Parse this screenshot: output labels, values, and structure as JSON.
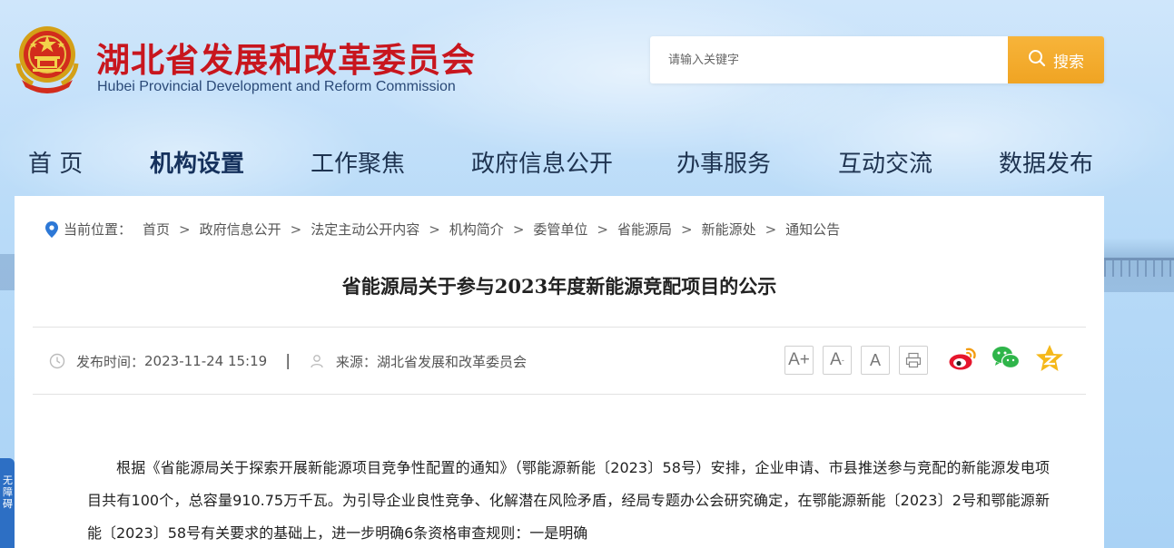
{
  "header": {
    "title": "湖北省发展和改革委员会",
    "subtitle": "Hubei Provincial Development and Reform Commission",
    "emblem_icon": "national-emblem-icon"
  },
  "search": {
    "placeholder": "请输入关键字",
    "button_label": "搜索"
  },
  "nav": {
    "items": [
      {
        "label": "首 页"
      },
      {
        "label": "机构设置"
      },
      {
        "label": "工作聚焦"
      },
      {
        "label": "政府信息公开"
      },
      {
        "label": "办事服务"
      },
      {
        "label": "互动交流"
      },
      {
        "label": "数据发布"
      }
    ],
    "active": "机构设置"
  },
  "side_tab": {
    "label": "无障碍"
  },
  "breadcrumb": {
    "prefix": "当前位置：",
    "separator": ">",
    "items": [
      "首页",
      "政府信息公开",
      "法定主动公开内容",
      "机构简介",
      "委管单位",
      "省能源局",
      "新能源处",
      "通知公告"
    ]
  },
  "article": {
    "title": "省能源局关于参与2023年度新能源竞配项目的公示",
    "publish_label": "发布时间：",
    "publish_time": "2023-11-24 15:19",
    "meta_divider": "|",
    "source_label": "来源：",
    "source": "湖北省发展和改革委员会",
    "paragraph": "根据《省能源局关于探索开展新能源项目竞争性配置的通知》（鄂能源新能〔2023〕58号）安排，企业申请、市县推送参与竞配的新能源发电项目共有100个，总容量910.75万千瓦。为引导企业良性竞争、化解潜在风险矛盾，经局专题办公会研究确定，在鄂能源新能〔2023〕2号和鄂能源新能〔2023〕58号有关要求的基础上，进一步明确6条资格审查规则：一是明确"
  },
  "font_tools": {
    "large": "A+",
    "medium": "A",
    "small": "A",
    "print_icon": "print-icon"
  },
  "share": {
    "weibo_icon": "weibo-icon",
    "wechat_icon": "wechat-icon",
    "qzone_icon": "qzone-icon"
  },
  "colors": {
    "brand_red": "#c8161e",
    "search_orange": "#f0a423",
    "nav_text": "#1e3350"
  }
}
